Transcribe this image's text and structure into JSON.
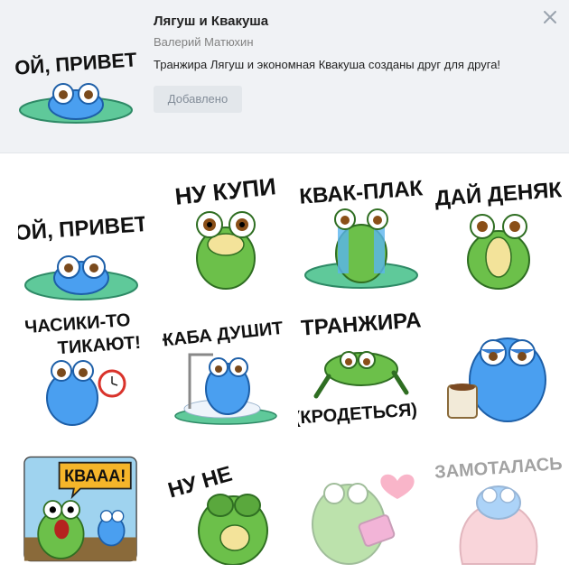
{
  "pack": {
    "title": "Лягуш и Квакуша",
    "author": "Валерий Матюхин",
    "description": "Транжира Лягуш и экономная Квакуша созданы друг для друга!",
    "added_label": "Добавлено",
    "cover_caption": "ОЙ, ПРИВЕТ"
  },
  "icons": {
    "close": "close-icon"
  },
  "colors": {
    "header_bg": "#f0f2f5",
    "frog_green": "#6cc04a",
    "frog_blue": "#3d8ce0"
  },
  "stickers": [
    {
      "caption": "ОЙ, ПРИВЕТ"
    },
    {
      "caption": "НУ КУПИ"
    },
    {
      "caption": "КВАК-ПЛАК"
    },
    {
      "caption": "ДАЙ ДЕНЯК"
    },
    {
      "caption": "ЧАСИКИ-ТО",
      "caption2": "ТИКАЮТ!"
    },
    {
      "caption": "ЖАБА ДУШИТ"
    },
    {
      "caption": "ТРАНЖИРА",
      "caption2": "(КРОДЕТЬСЯ)"
    },
    {
      "caption": ""
    },
    {
      "caption": "КВААА!"
    },
    {
      "caption": "НУ НЕ"
    },
    {
      "caption": ""
    },
    {
      "caption": "ЗАМОТАЛАСЬ"
    }
  ]
}
